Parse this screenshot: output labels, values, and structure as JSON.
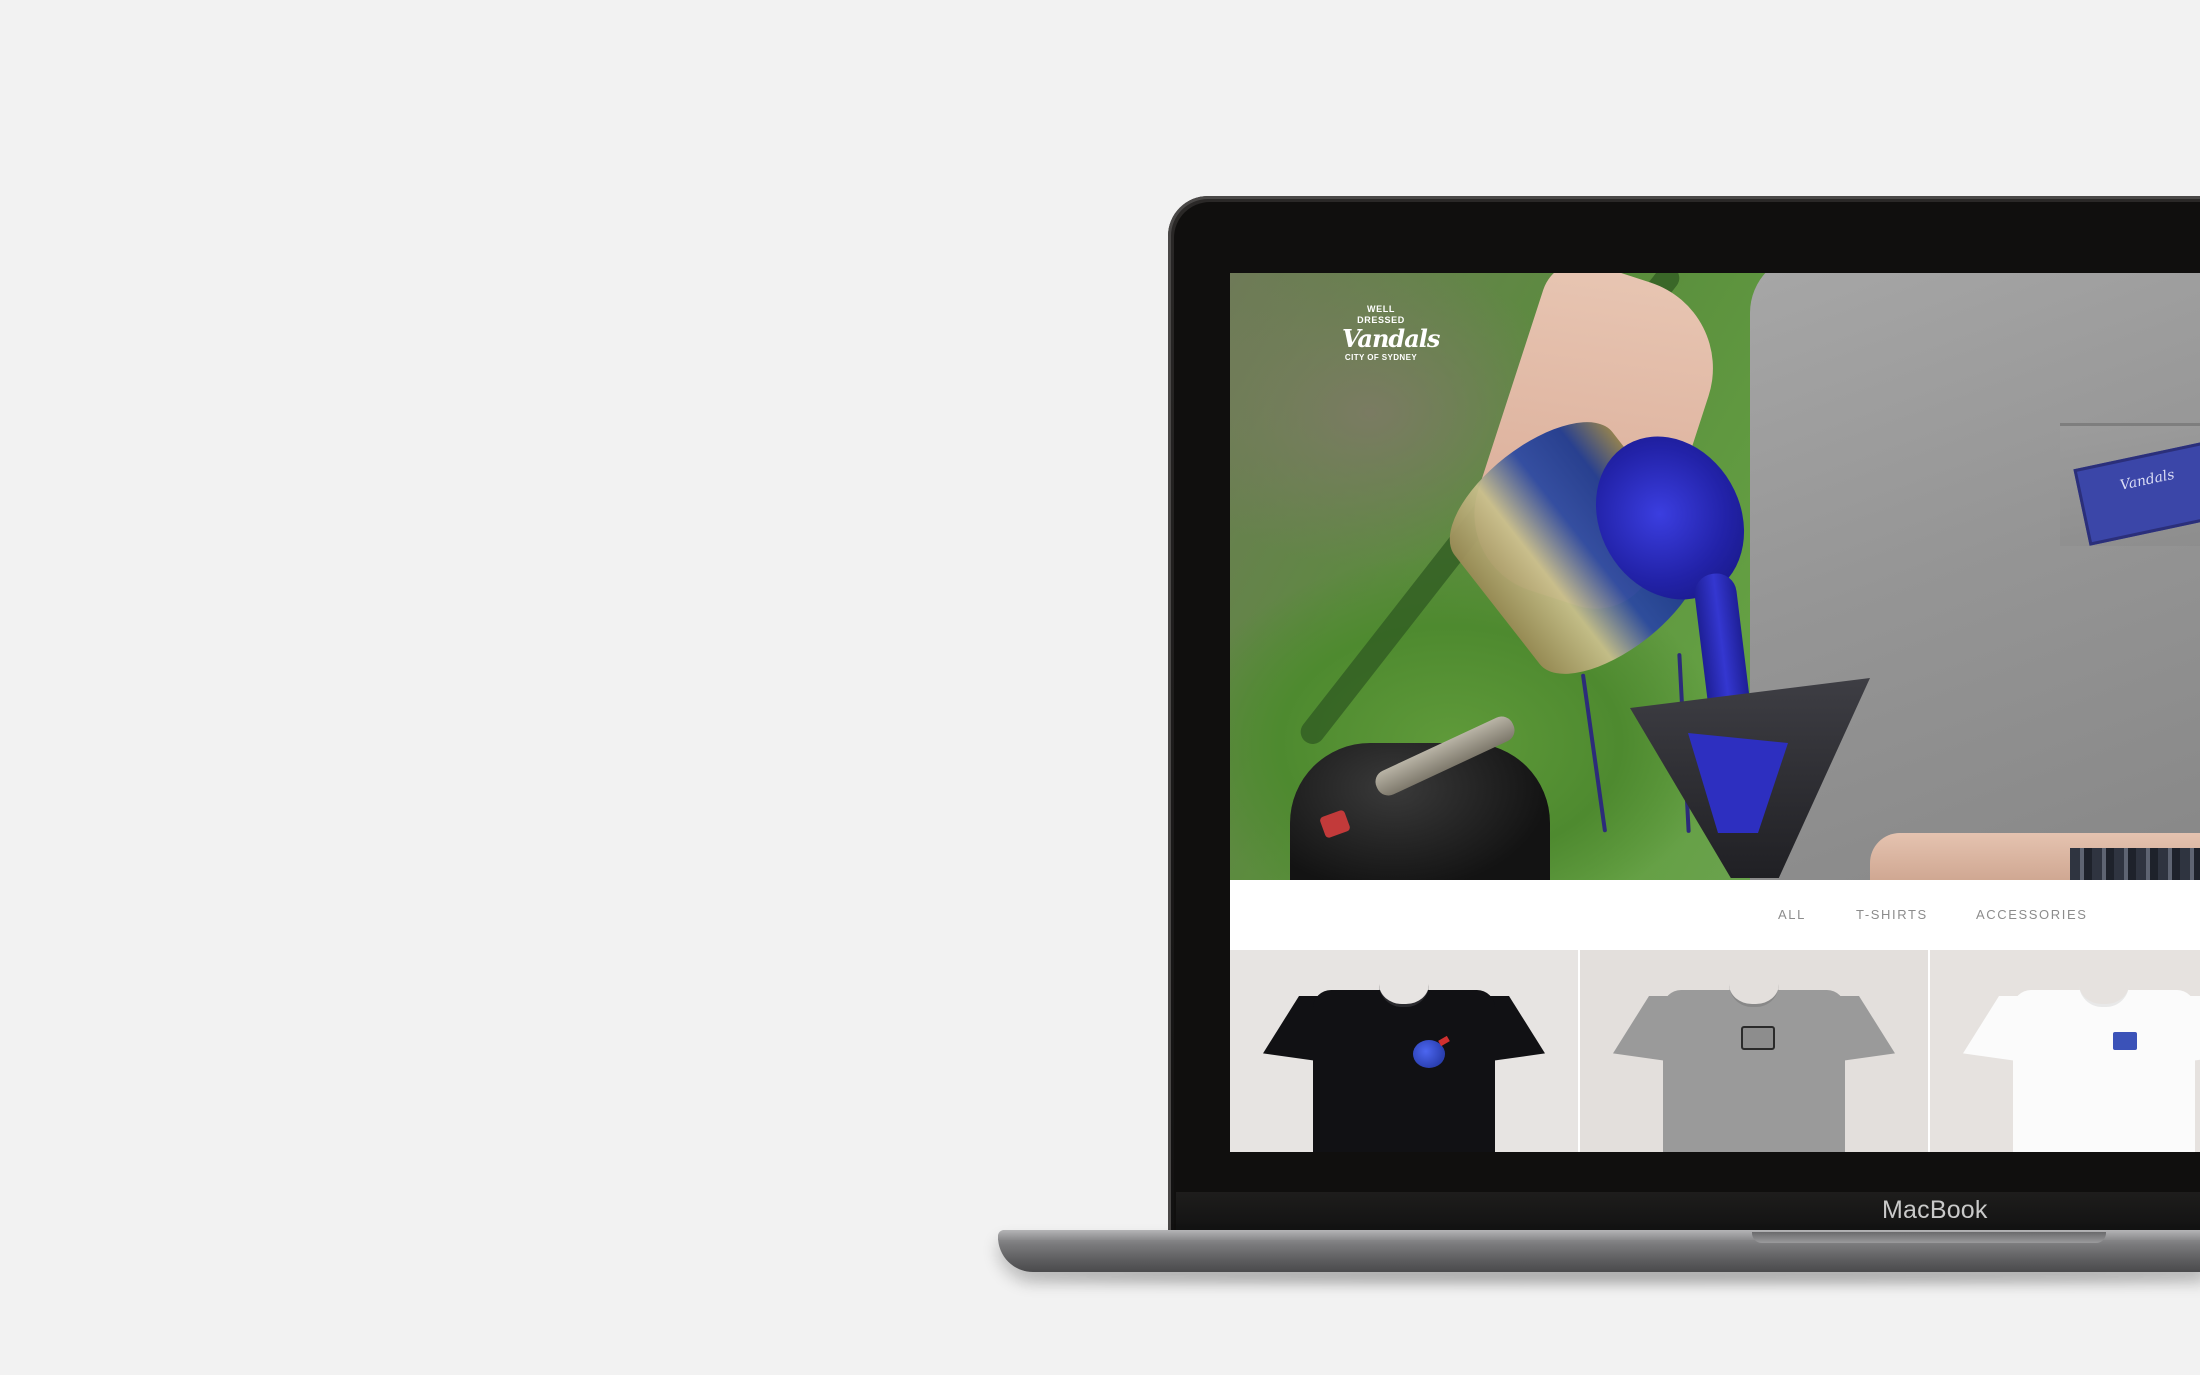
{
  "device": {
    "brand_label": "MacBook"
  },
  "site": {
    "logo": {
      "line_top": "WELL DRESSED",
      "line_main": "Vandals",
      "line_bottom": "CITY OF SYDNEY"
    },
    "hero": {
      "pocket_badge_text": "Vandals"
    },
    "filters": [
      {
        "label": "ALL"
      },
      {
        "label": "T-SHIRTS"
      },
      {
        "label": "ACCESSORIES"
      }
    ],
    "products": [
      {
        "color": "#111114",
        "icon": "black-tshirt"
      },
      {
        "color": "#9a9a9a",
        "icon": "grey-tshirt"
      },
      {
        "color": "#fbfbfb",
        "icon": "white-tshirt"
      }
    ]
  },
  "colors": {
    "background": "#f2f2f2",
    "bezel": "#100f0e",
    "paint_blue": "#2d2fc0",
    "filter_text": "#8c8c8c"
  }
}
